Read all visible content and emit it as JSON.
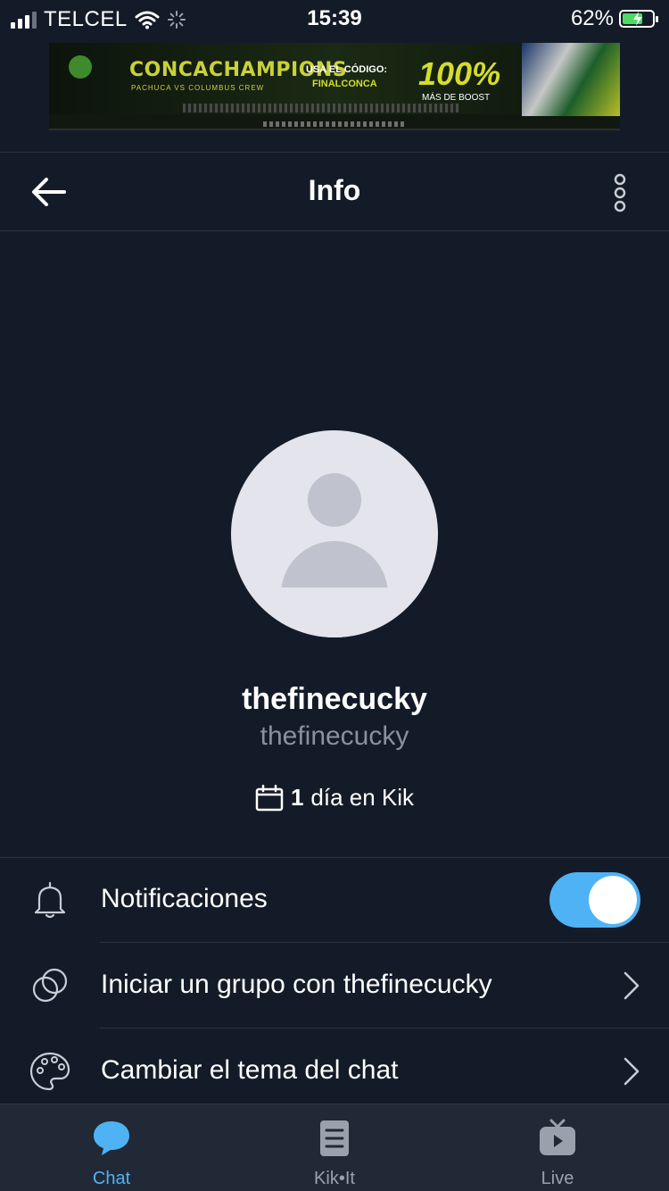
{
  "status_bar": {
    "carrier": "TELCEL",
    "time": "15:39",
    "battery_percent": "62%"
  },
  "ad": {
    "title": "CONCACHAMPIONS",
    "subtitle": "PACHUCA VS COLUMBUS CREW",
    "code_label": "USA EL CÓDIGO:",
    "code": "FINALCONCA",
    "percent": "100%",
    "boost": "MÁS DE BOOST"
  },
  "header": {
    "title": "Info"
  },
  "profile": {
    "display_name": "thefinecucky",
    "username": "thefinecucky",
    "days_count": "1",
    "days_text": "día en Kik"
  },
  "settings": {
    "notifications_label": "Notificaciones",
    "notifications_enabled": true,
    "start_group_label": "Iniciar un grupo con thefinecucky",
    "change_theme_label": "Cambiar el tema del chat"
  },
  "bottom_nav": {
    "items": [
      {
        "label": "Chat",
        "active": true
      },
      {
        "label": "Kik•It",
        "active": false
      },
      {
        "label": "Live",
        "active": false
      }
    ]
  },
  "colors": {
    "background": "#141b28",
    "accent": "#4fb2f5",
    "nav_background": "#212937",
    "muted_text": "#8a909c"
  }
}
